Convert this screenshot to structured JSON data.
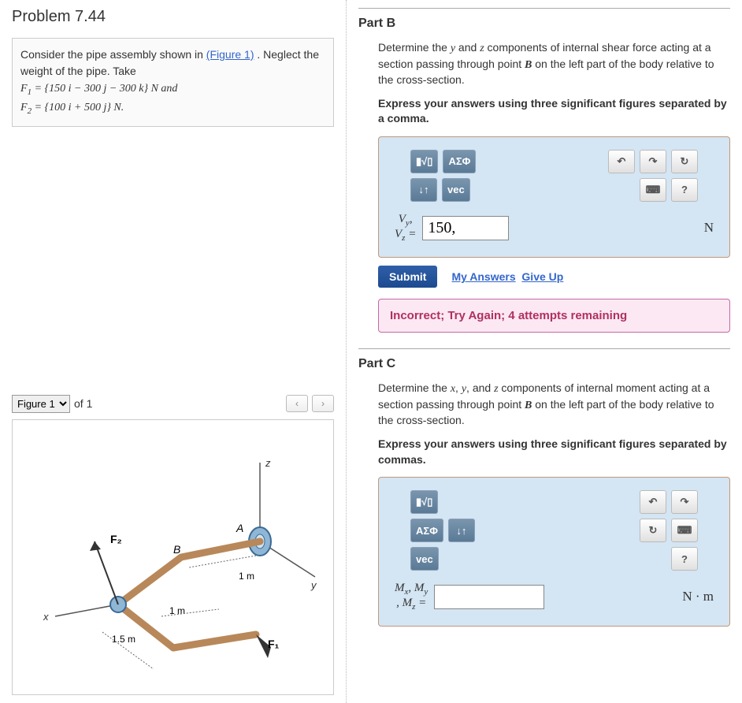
{
  "problem": {
    "title": "Problem 7.44",
    "intro_pre": "Consider the pipe assembly shown in ",
    "figure_link": "(Figure 1)",
    "intro_post": " . Neglect the weight of the pipe. Take",
    "force1_html": "F<sub>1</sub> = {150 i − 300 j − 300 k} N and",
    "force2_html": "F<sub>2</sub> = {100 i + 500 j} N."
  },
  "figure": {
    "selected": "Figure 1",
    "of_label": "of 1",
    "labels": {
      "A": "A",
      "B": "B",
      "F1": "F₁",
      "F2": "F₂",
      "m1a": "1 m",
      "m1b": "1 m",
      "m15": "1.5 m",
      "x": "x",
      "y": "y",
      "z": "z"
    }
  },
  "partB": {
    "title": "Part B",
    "desc": "Determine the y and z components of internal shear force acting at a section passing through point B on the left part of the body relative to the cross-section.",
    "instr": "Express your answers using three significant figures separated by a comma.",
    "toolbar": {
      "frac": "▮√▯",
      "symb": "ΑΣΦ",
      "arrows": "↓↑",
      "vec": "vec",
      "undo": "↶",
      "redo": "↷",
      "reset": "↻",
      "keyb": "⌨",
      "help": "?"
    },
    "var_html": "V<sub>y</sub>,<br>V<sub>z</sub> =",
    "value": "150,",
    "unit": "N",
    "submit": "Submit",
    "my_answers": "My Answers",
    "give_up": "Give Up",
    "feedback": "Incorrect; Try Again; 4 attempts remaining"
  },
  "partC": {
    "title": "Part C",
    "desc": "Determine the x, y, and z components of internal moment acting at a section passing through point B on the left part of the body relative to the cross-section.",
    "instr": "Express your answers using three significant figures separated by commas.",
    "toolbar": {
      "frac": "▮√▯",
      "symb": "ΑΣΦ",
      "arrows": "↓↑",
      "vec": "vec",
      "undo": "↶",
      "redo": "↷",
      "reset": "↻",
      "keyb": "⌨",
      "help": "?"
    },
    "var_html": "M<sub>x</sub>, M<sub>y</sub><br>, M<sub>z</sub> =",
    "value": "",
    "unit": "N · m"
  }
}
